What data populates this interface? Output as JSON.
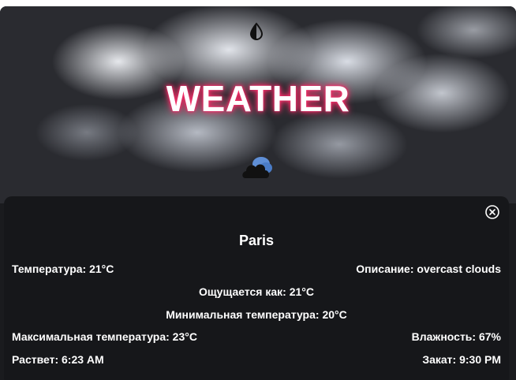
{
  "header": {
    "title": "WEATHER",
    "theme_toggle_icon": "half-drop-icon",
    "weather_icon": "cloud-icon"
  },
  "details": {
    "close_icon": "close-circle-icon",
    "city": "Paris",
    "temperature": "Температура: 21°C",
    "description": "Описание: overcast clouds",
    "feels_like": "Ощущается как: 21°C",
    "min_temp": "Минимальная температура: 20°C",
    "max_temp": "Максимальная температура: 23°C",
    "humidity": "Влажность: 67%",
    "sunrise": "Раствет: 6:23 AM",
    "sunset": "Закат: 9:30 PM"
  },
  "colors": {
    "title_glow": "#ff2f6b",
    "panel_bg": "#16171a",
    "text": "#ffffff"
  }
}
